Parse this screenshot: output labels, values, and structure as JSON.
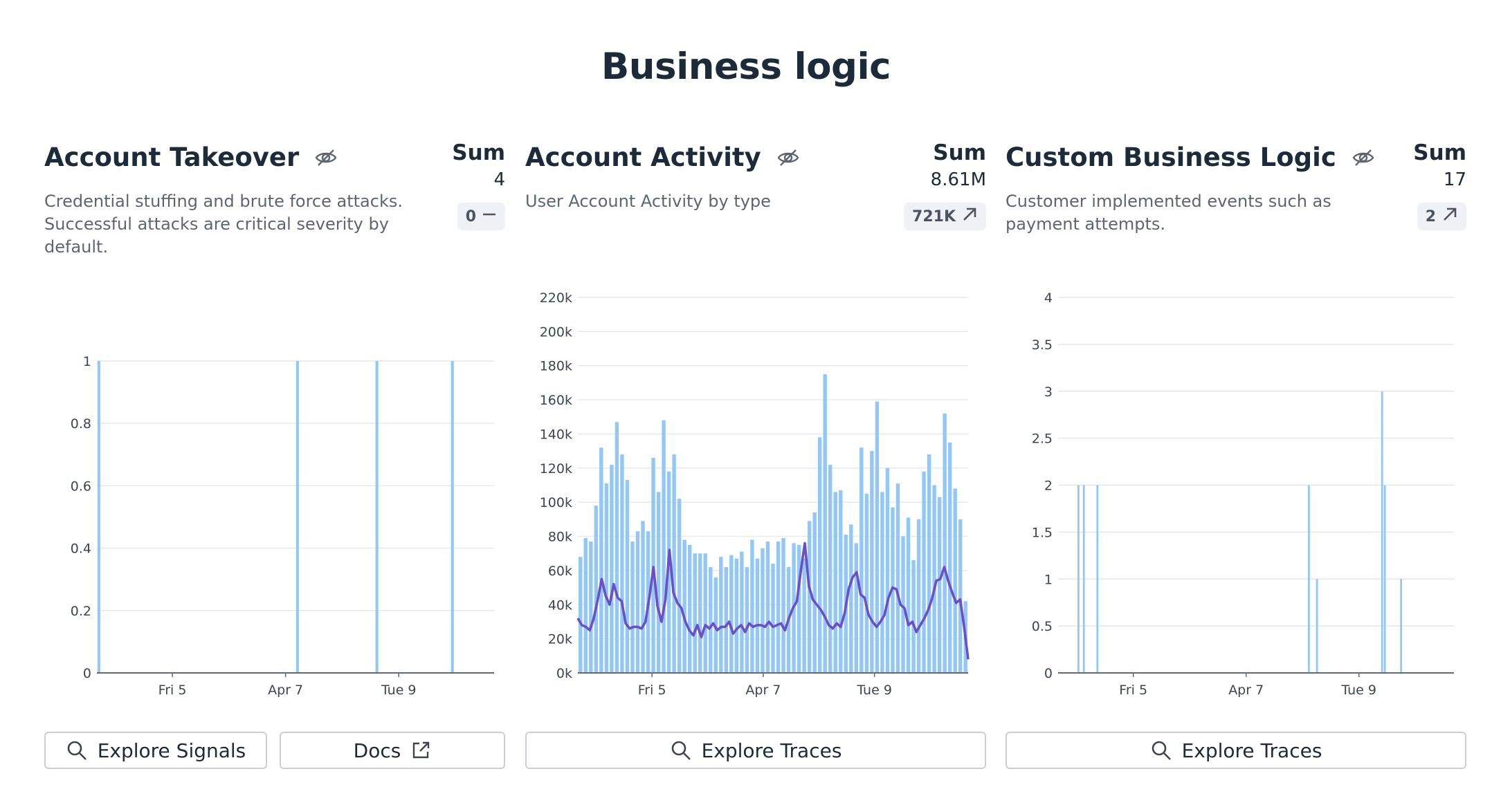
{
  "page": {
    "title": "Business logic"
  },
  "panels": [
    {
      "title": "Account Takeover",
      "description": "Credential stuffing and brute force attacks. Successful attacks are critical severity by default.",
      "sum_label": "Sum",
      "sum_value": "4",
      "change": "0",
      "change_icon": "dash-icon",
      "buttons": [
        {
          "label": "Explore Signals",
          "icon": "search-icon"
        },
        {
          "label": "Docs",
          "icon": "external-link-icon"
        }
      ]
    },
    {
      "title": "Account Activity",
      "description": "User Account Activity by type",
      "sum_label": "Sum",
      "sum_value": "8.61M",
      "change": "721K",
      "change_icon": "arrow-up-right-icon",
      "buttons": [
        {
          "label": "Explore Traces",
          "icon": "search-icon"
        }
      ]
    },
    {
      "title": "Custom Business Logic",
      "description": "Customer implemented events such as payment attempts.",
      "sum_label": "Sum",
      "sum_value": "17",
      "change": "2",
      "change_icon": "arrow-up-right-icon",
      "buttons": [
        {
          "label": "Explore Traces",
          "icon": "search-icon"
        }
      ]
    }
  ],
  "colors": {
    "bar": "#93c7f6",
    "line": "#6a4fc8",
    "grid": "#e3e7ec",
    "axis": "#5a6b7d"
  },
  "chart_data": [
    {
      "type": "bar",
      "ylim": [
        0,
        1
      ],
      "yticks": [
        "0",
        "0.2",
        "0.4",
        "0.6",
        "0.8",
        "1"
      ],
      "xticks": [
        "Fri 5",
        "Apr 7",
        "Tue 9"
      ],
      "xtick_positions": [
        0.19,
        0.475,
        0.76
      ],
      "values": [
        1,
        0,
        0,
        0,
        0,
        0,
        0,
        0,
        0,
        0,
        0,
        0,
        0,
        0,
        0,
        0,
        0,
        0,
        0,
        0,
        0,
        0,
        0,
        0,
        0,
        0,
        0,
        0,
        0,
        0,
        0,
        0,
        0,
        0,
        0,
        0,
        0,
        0,
        0,
        0,
        0,
        0,
        0,
        0,
        0,
        0,
        0,
        0,
        0,
        0,
        1,
        0,
        0,
        0,
        0,
        0,
        0,
        0,
        0,
        0,
        0,
        0,
        0,
        0,
        0,
        0,
        0,
        0,
        0,
        0,
        1,
        0,
        0,
        0,
        0,
        0,
        0,
        0,
        0,
        0,
        0,
        0,
        0,
        0,
        0,
        0,
        0,
        0,
        0,
        1,
        0,
        0,
        0,
        0,
        0,
        0,
        0,
        0,
        0,
        0
      ]
    },
    {
      "type": "bar+line",
      "ylim": [
        0,
        220000
      ],
      "yticks": [
        "0k",
        "20k",
        "40k",
        "60k",
        "80k",
        "100k",
        "120k",
        "140k",
        "160k",
        "180k",
        "200k",
        "220k"
      ],
      "xticks": [
        "Fri 5",
        "Apr 7",
        "Tue 9"
      ],
      "xtick_positions": [
        0.19,
        0.475,
        0.76
      ],
      "series": [
        {
          "type": "bar",
          "values": [
            68000,
            79000,
            77000,
            98000,
            132000,
            111000,
            122000,
            147000,
            128000,
            113000,
            77000,
            83000,
            89000,
            83000,
            126000,
            106000,
            148000,
            118000,
            128000,
            102000,
            78000,
            75000,
            70000,
            70000,
            70000,
            62000,
            56000,
            68000,
            62000,
            69000,
            67000,
            71000,
            62000,
            78000,
            67000,
            73000,
            77000,
            64000,
            77000,
            79000,
            62000,
            76000,
            75000,
            67000,
            89000,
            94000,
            138000,
            175000,
            122000,
            106000,
            107000,
            81000,
            87000,
            76000,
            132000,
            105000,
            130000,
            159000,
            106000,
            120000,
            97000,
            111000,
            80000,
            91000,
            66000,
            90000,
            118000,
            128000,
            110000,
            103000,
            152000,
            135000,
            108000,
            90000,
            42000
          ]
        },
        {
          "type": "line",
          "values": [
            32000,
            28000,
            27000,
            25000,
            32000,
            43000,
            55000,
            45000,
            40000,
            52000,
            44000,
            42000,
            29000,
            26000,
            27000,
            27000,
            26000,
            30000,
            45000,
            62000,
            39000,
            30000,
            43000,
            72000,
            47000,
            41000,
            38000,
            30000,
            25000,
            22000,
            28000,
            21000,
            28000,
            26000,
            29000,
            25000,
            27000,
            27000,
            30000,
            23000,
            26000,
            28000,
            24000,
            29000,
            27000,
            28000,
            28000,
            27000,
            30000,
            27000,
            28000,
            29000,
            25000,
            32000,
            38000,
            42000,
            60000,
            76000,
            51000,
            43000,
            40000,
            37000,
            33000,
            28000,
            26000,
            29000,
            27000,
            35000,
            49000,
            56000,
            59000,
            46000,
            44000,
            34000,
            30000,
            27000,
            30000,
            34000,
            44000,
            50000,
            49000,
            40000,
            38000,
            28000,
            30000,
            24000,
            28000,
            32000,
            37000,
            44000,
            54000,
            55000,
            62000,
            54000,
            47000,
            41000,
            43000,
            27000,
            8000
          ]
        }
      ]
    },
    {
      "type": "bar",
      "ylim": [
        0,
        4
      ],
      "yticks": [
        "0",
        "0.5",
        "1",
        "1.5",
        "2",
        "2.5",
        "3",
        "3.5",
        "4"
      ],
      "xticks": [
        "Fri 5",
        "Apr 7",
        "Tue 9"
      ],
      "xtick_positions": [
        0.19,
        0.475,
        0.76
      ],
      "values": [
        0,
        0,
        0,
        0,
        0,
        0,
        0,
        2,
        0,
        2,
        0,
        0,
        0,
        0,
        2,
        0,
        0,
        0,
        0,
        0,
        0,
        0,
        0,
        0,
        0,
        0,
        0,
        0,
        0,
        0,
        0,
        0,
        0,
        0,
        0,
        0,
        0,
        0,
        0,
        0,
        0,
        0,
        0,
        0,
        0,
        0,
        0,
        0,
        0,
        0,
        0,
        0,
        0,
        0,
        0,
        0,
        0,
        0,
        0,
        0,
        0,
        0,
        0,
        0,
        0,
        0,
        0,
        0,
        0,
        0,
        0,
        0,
        0,
        0,
        0,
        0,
        0,
        0,
        0,
        0,
        0,
        0,
        0,
        0,
        0,
        0,
        0,
        0,
        0,
        0,
        0,
        0,
        2,
        0,
        0,
        1,
        0,
        0,
        0,
        0,
        0,
        0,
        0,
        0,
        0,
        0,
        0,
        0,
        0,
        0,
        0,
        0,
        0,
        0,
        0,
        0,
        0,
        0,
        0,
        3,
        2,
        0,
        0,
        0,
        0,
        0,
        1,
        0,
        0,
        0,
        0,
        0,
        0,
        0,
        0,
        0,
        0,
        0,
        0,
        0,
        0,
        0,
        0,
        0,
        0,
        0
      ]
    }
  ]
}
